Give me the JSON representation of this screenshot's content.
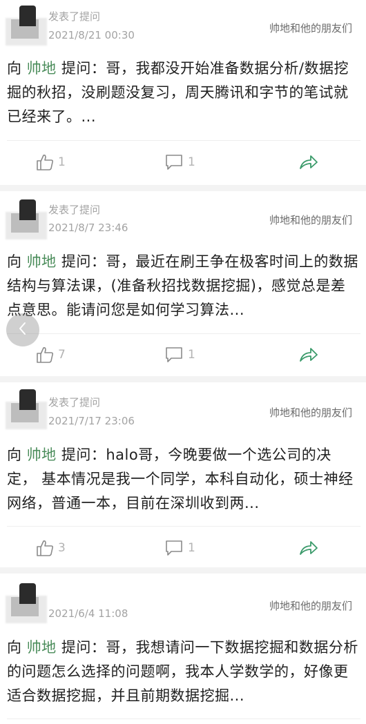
{
  "posts": [
    {
      "asked_label": "发表了提问",
      "time": "2021/8/21 00:30",
      "circle": "帅地和他的朋友们",
      "to_label": "向",
      "author": "帅地",
      "q_label": "提问：",
      "text": "哥，我都没开始准备数据分析/数据挖掘的秋招，没刷题没复习，周天腾讯和字节的笔试就已经来了。...",
      "likes": "1",
      "comments": "1"
    },
    {
      "asked_label": "发表了提问",
      "time": "2021/8/7 23:46",
      "circle": "帅地和他的朋友们",
      "to_label": "向",
      "author": "帅地",
      "q_label": "提问：",
      "text": "哥，最近在刷王争在极客时间上的数据结构与算法课，(准备秋招找数据挖掘)，感觉总是差点意思。能请问您是如何学习算法...",
      "likes": "7",
      "comments": "1"
    },
    {
      "asked_label": "发表了提问",
      "time": "2021/7/17 23:06",
      "circle": "帅地和他的朋友们",
      "to_label": "向",
      "author": "帅地",
      "q_label": "提问：",
      "text": "halo哥，今晚要做一个选公司的决定， 基本情况是我一个同学，本科自动化，硕士神经网络，普通一本，目前在深圳收到两...",
      "likes": "3",
      "comments": "1"
    },
    {
      "asked_label": "",
      "time": "2021/6/4 11:08",
      "circle": "帅地和他的朋友们",
      "to_label": "向",
      "author": "帅地",
      "q_label": "提问：",
      "text": "哥，我想请问一下数据挖掘和数据分析的问题怎么选择的问题啊，我本人学数学的，好像更适合数据挖掘，并且前期数据挖掘...",
      "likes": "",
      "comments": ""
    }
  ],
  "icons": {
    "like": "thumbs-up-icon",
    "comment": "comment-icon",
    "share": "share-arrow-icon",
    "back": "chevron-left-icon"
  },
  "colors": {
    "name": "#4a8c5a",
    "share": "#3a9a6a",
    "meta": "#a3a3a3"
  }
}
